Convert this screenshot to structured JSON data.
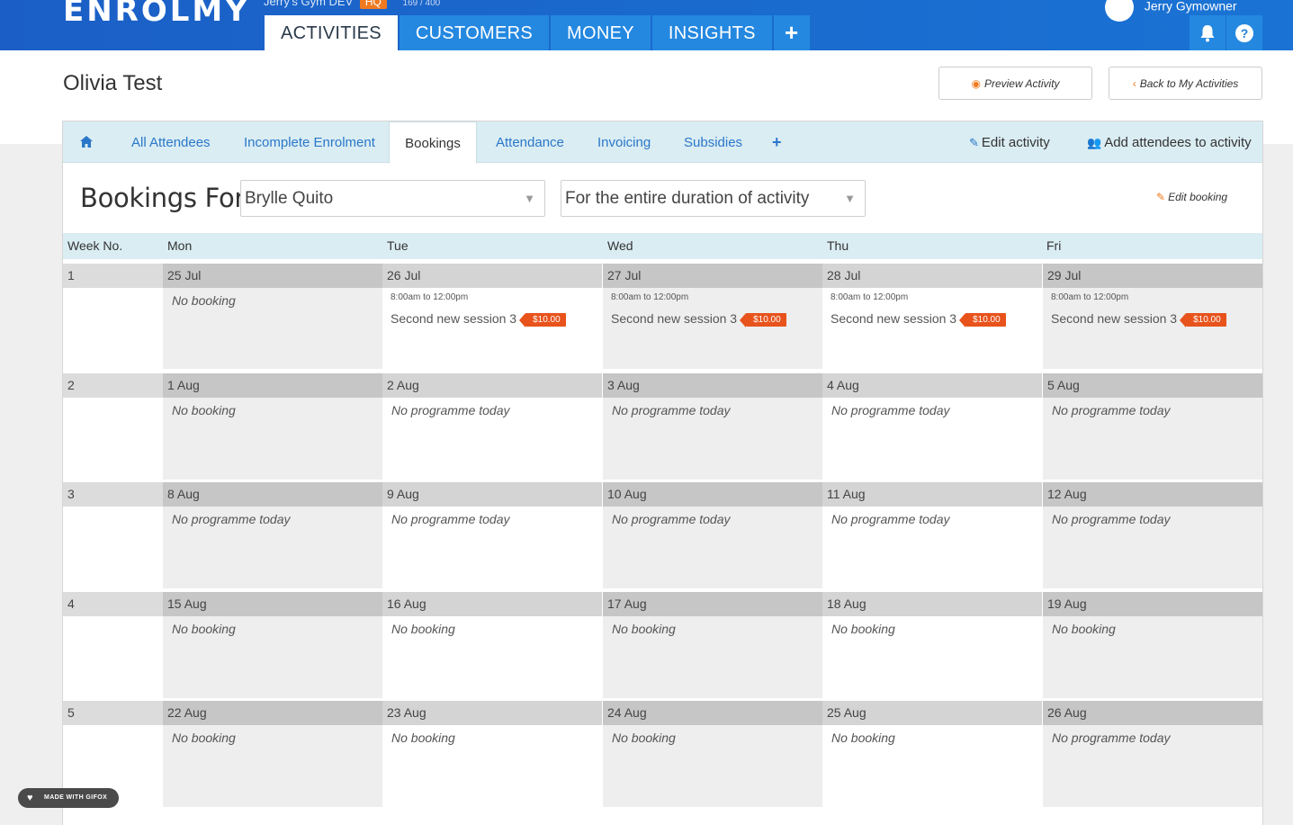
{
  "header": {
    "logo": "ENROLMY",
    "account": "Jerry's Gym DEV",
    "account_badge": "HQ",
    "account_count": "169 / 400",
    "user": "Jerry Gymowner",
    "tabs": [
      {
        "label": "ACTIVITIES"
      },
      {
        "label": "CUSTOMERS"
      },
      {
        "label": "MONEY"
      },
      {
        "label": "INSIGHTS"
      }
    ],
    "plus_label": "+",
    "help_label": "?"
  },
  "page": {
    "title": "Olivia Test",
    "preview_label": "Preview Activity",
    "back_label": "Back to My Activities"
  },
  "subnav": {
    "items": [
      {
        "label": "All Attendees"
      },
      {
        "label": "Incomplete Enrolment"
      },
      {
        "label": "Bookings"
      },
      {
        "label": "Attendance"
      },
      {
        "label": "Invoicing"
      },
      {
        "label": "Subsidies"
      }
    ],
    "plus_label": "+",
    "edit_activity": "Edit activity",
    "add_attendees": "Add attendees to activity"
  },
  "bookings": {
    "label": "Bookings For",
    "attendee": "Brylle Quito",
    "duration": "For the entire duration of activity",
    "edit_booking": "Edit booking"
  },
  "grid": {
    "headers": {
      "week": "Week No.",
      "days": [
        "Mon",
        "Tue",
        "Wed",
        "Thu",
        "Fri"
      ]
    },
    "weeks": [
      {
        "num": "1",
        "days": [
          {
            "date": "25 Jul",
            "text": "No booking"
          },
          {
            "date": "26 Jul",
            "time": "8:00am to 12:00pm",
            "session": "Second new session 3",
            "price": "$10.00"
          },
          {
            "date": "27 Jul",
            "time": "8:00am to 12:00pm",
            "session": "Second new session 3",
            "price": "$10.00"
          },
          {
            "date": "28 Jul",
            "time": "8:00am to 12:00pm",
            "session": "Second new session 3",
            "price": "$10.00"
          },
          {
            "date": "29 Jul",
            "time": "8:00am to 12:00pm",
            "session": "Second new session 3",
            "price": "$10.00"
          }
        ]
      },
      {
        "num": "2",
        "days": [
          {
            "date": "1 Aug",
            "text": "No booking"
          },
          {
            "date": "2 Aug",
            "text": "No programme today"
          },
          {
            "date": "3 Aug",
            "text": "No programme today"
          },
          {
            "date": "4 Aug",
            "text": "No programme today"
          },
          {
            "date": "5 Aug",
            "text": "No programme today"
          }
        ]
      },
      {
        "num": "3",
        "days": [
          {
            "date": "8 Aug",
            "text": "No programme today"
          },
          {
            "date": "9 Aug",
            "text": "No programme today"
          },
          {
            "date": "10 Aug",
            "text": "No programme today"
          },
          {
            "date": "11 Aug",
            "text": "No programme today"
          },
          {
            "date": "12 Aug",
            "text": "No programme today"
          }
        ]
      },
      {
        "num": "4",
        "days": [
          {
            "date": "15 Aug",
            "text": "No booking"
          },
          {
            "date": "16 Aug",
            "text": "No booking"
          },
          {
            "date": "17 Aug",
            "text": "No booking"
          },
          {
            "date": "18 Aug",
            "text": "No booking"
          },
          {
            "date": "19 Aug",
            "text": "No booking"
          }
        ]
      },
      {
        "num": "5",
        "days": [
          {
            "date": "22 Aug",
            "text": "No booking"
          },
          {
            "date": "23 Aug",
            "text": "No booking"
          },
          {
            "date": "24 Aug",
            "text": "No booking"
          },
          {
            "date": "25 Aug",
            "text": "No booking"
          },
          {
            "date": "26 Aug",
            "text": "No programme today"
          }
        ]
      }
    ]
  },
  "watermark": "MADE WITH GIFOX",
  "colors": {
    "brand_blue": "#1b5fc6",
    "tab_blue": "#2488e0",
    "accent_orange": "#e8531c",
    "subnav_bg": "#daedf3"
  }
}
